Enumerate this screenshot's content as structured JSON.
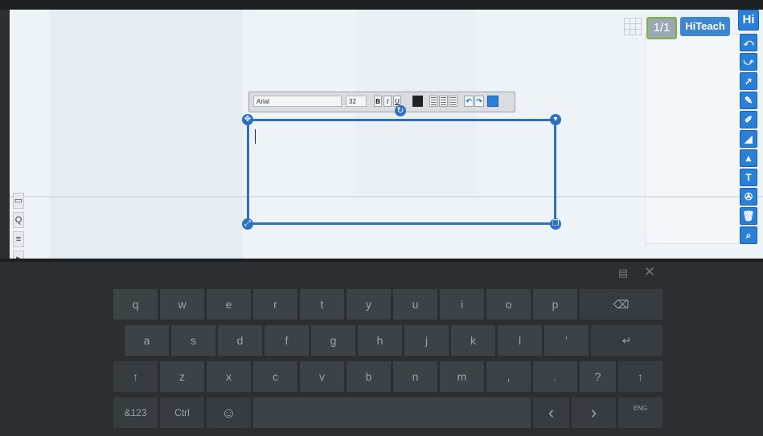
{
  "toolbar": {
    "page_indicator": "1/1",
    "hiteach_label": "HiTeach",
    "right_tools": [
      "Hi",
      "⤺",
      "⤻",
      "➚",
      "✎",
      "✐",
      "◢",
      "▲",
      "T",
      "✇",
      "🗑",
      "⌕"
    ]
  },
  "left_tools": [
    "▭",
    "Q",
    "≡",
    "▸"
  ],
  "format_bar": {
    "font": "Arial",
    "size": "32",
    "bold": "B",
    "italic": "I",
    "underline": "U",
    "undo": "↶",
    "redo": "↷"
  },
  "colors": {
    "accent": "#2f6fc0",
    "keyboard_bg": "#2b2f31",
    "key_bg": "#3c4347",
    "key_text": "#9aa4aa"
  },
  "keyboard": {
    "row1": [
      "q",
      "w",
      "e",
      "r",
      "t",
      "y",
      "u",
      "i",
      "o",
      "p",
      "⌫"
    ],
    "row2": [
      "a",
      "s",
      "d",
      "f",
      "g",
      "h",
      "j",
      "k",
      "l",
      "'",
      "↵"
    ],
    "row3": [
      "↑",
      "z",
      "x",
      "c",
      "v",
      "b",
      "n",
      "m",
      ",",
      ".",
      "?",
      "↑"
    ],
    "row4": [
      "&123",
      "Ctrl",
      "☺",
      "",
      "‹",
      "›",
      "ENG"
    ]
  },
  "keyboard_controls": {
    "menu": "▤",
    "close": "✕"
  }
}
